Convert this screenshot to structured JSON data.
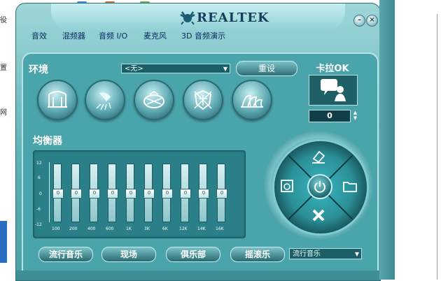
{
  "colors": {
    "accent": "#4aa4ab",
    "text": "#ffffff",
    "tab_text": "#0b2a63"
  },
  "desktop": {
    "glyphs": [
      "役",
      "置",
      "网"
    ]
  },
  "window": {
    "brand": "REALTEK",
    "minimize_label": "–",
    "close_label": "×"
  },
  "tabs": [
    "音效",
    "混频器",
    "音频 I/O",
    "麦克风",
    "3D 音频演示"
  ],
  "environment": {
    "label": "环境",
    "selected": "<无>",
    "reset_label": "重设",
    "presets": [
      "bathroom-icon",
      "shower-icon",
      "stadium-icon",
      "knight-icon",
      "opera-house-icon"
    ]
  },
  "karaoke": {
    "label": "卡拉OK",
    "value": "0"
  },
  "equalizer": {
    "label": "均衡器",
    "scale": [
      "12",
      "6",
      "0",
      "-6",
      "-12"
    ],
    "bands": [
      "100",
      "200",
      "400",
      "600",
      "1K",
      "3K",
      "6K",
      "12K",
      "14K",
      "16K"
    ],
    "knob_label": "0",
    "values": [
      0,
      0,
      0,
      0,
      0,
      0,
      0,
      0,
      0,
      0
    ],
    "range": [
      -12,
      12
    ],
    "presets": [
      "流行音乐",
      "现场",
      "俱乐部",
      "摇滚乐"
    ],
    "selected": "流行音乐"
  }
}
